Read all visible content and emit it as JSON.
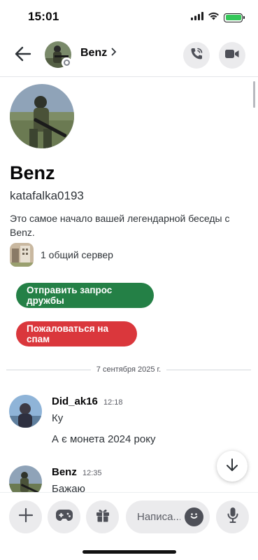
{
  "status_bar": {
    "time": "15:01"
  },
  "header": {
    "name": "Benz"
  },
  "profile": {
    "name": "Benz",
    "username": "katafalka0193",
    "intro": "Это самое начало вашей легендарной беседы с Benz.",
    "mutual_servers": "1 общий сервер",
    "add_friend_label": "Отправить запрос дружбы",
    "report_spam_label": "Пожаловаться на спам"
  },
  "date_divider": "7 сентября 2025 г.",
  "messages": [
    {
      "author": "Did_ak16",
      "time": "12:18",
      "lines": [
        "Ку",
        "А є монета 2024 року"
      ]
    },
    {
      "author": "Benz",
      "time": "12:35",
      "lines": [
        "Бажаю"
      ]
    }
  ],
  "composer": {
    "placeholder": "Написа..."
  },
  "icons": {
    "back": "arrow-left-icon",
    "chevron": "chevron-right-icon",
    "call": "phone-call-icon",
    "video": "video-camera-icon",
    "scroll_down": "arrow-down-icon",
    "plus": "plus-icon",
    "games": "gamepad-icon",
    "gift": "gift-icon",
    "emoji": "emoji-icon",
    "mic": "microphone-icon"
  },
  "colors": {
    "friend_button": "#248046",
    "spam_button": "#da373c",
    "battery": "#34c759",
    "presence_offline": "#80848e"
  }
}
